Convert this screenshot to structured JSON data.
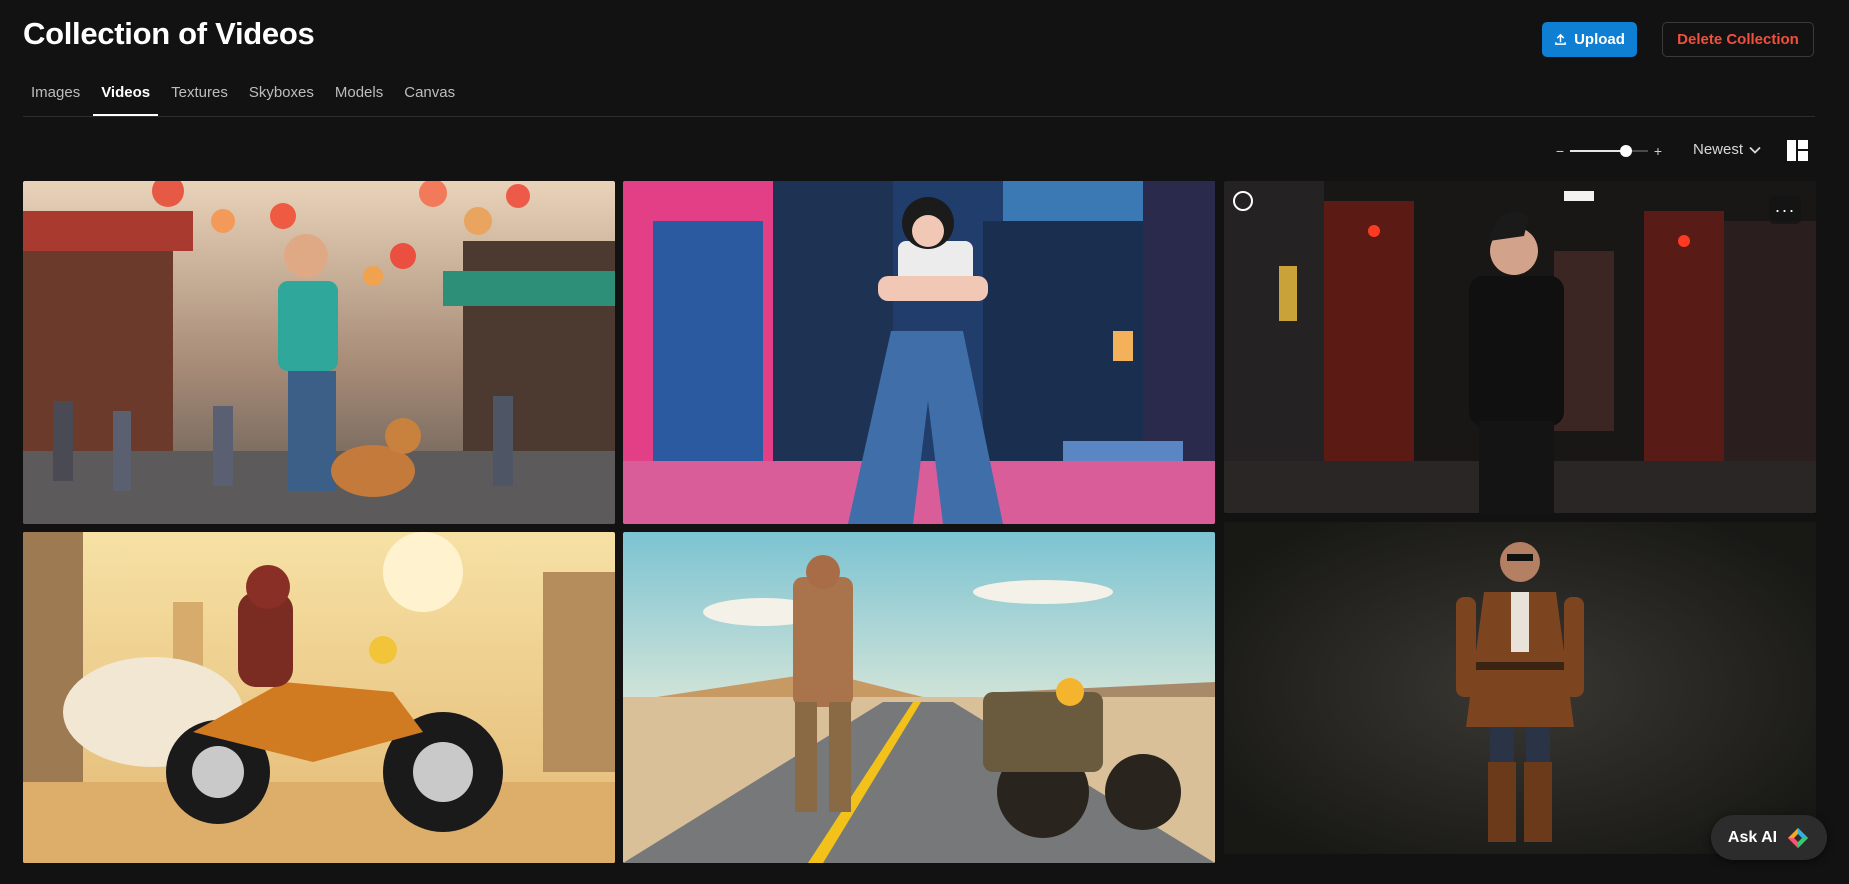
{
  "page": {
    "title": "Collection of Videos"
  },
  "header": {
    "upload_label": "Upload",
    "delete_label": "Delete Collection",
    "upload_icon": "upload-icon"
  },
  "tabs": [
    {
      "label": "Images",
      "active": false
    },
    {
      "label": "Videos",
      "active": true
    },
    {
      "label": "Textures",
      "active": false
    },
    {
      "label": "Skyboxes",
      "active": false
    },
    {
      "label": "Models",
      "active": false
    },
    {
      "label": "Canvas",
      "active": false
    }
  ],
  "toolbar": {
    "zoom_minus": "−",
    "zoom_plus": "+",
    "zoom_level": 0.72,
    "sort_label": "Newest",
    "layout_icon": "masonry-layout-icon"
  },
  "videos": [
    {
      "subject": "man-with-dog-lantern-street"
    },
    {
      "subject": "punk-woman-neon-alley"
    },
    {
      "subject": "woman-in-black-suit-red-corridor"
    },
    {
      "subject": "rider-on-motorcycle-desert-cartoon"
    },
    {
      "subject": "wasteland-man-and-motorcycle-road"
    },
    {
      "subject": "man-in-leather-trench-coat"
    }
  ],
  "tile_overlay": {
    "more_label": "···"
  },
  "assistant": {
    "label": "Ask AI"
  },
  "colors": {
    "background": "#121212",
    "primary": "#0e7fd3",
    "danger": "#f2503c"
  }
}
